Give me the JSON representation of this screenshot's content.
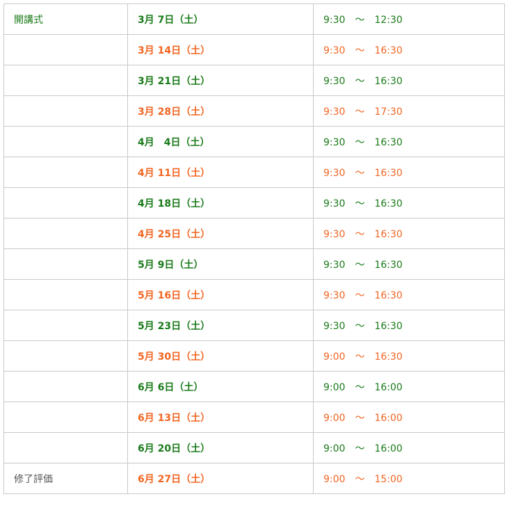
{
  "colors": {
    "green": "#1a7a1a",
    "orange": "#f26522",
    "label_gray": "#555555"
  },
  "rows": [
    {
      "label": "開講式",
      "date": "3月 7日（土）",
      "time": "9:30　～　12:30",
      "tone": "green"
    },
    {
      "label": "",
      "date": "3月 14日（土）",
      "time": "9:30　～　16:30",
      "tone": "orange"
    },
    {
      "label": "",
      "date": "3月 21日（土）",
      "time": "9:30　～　16:30",
      "tone": "green"
    },
    {
      "label": "",
      "date": "3月 28日（土）",
      "time": "9:30　～　17:30",
      "tone": "orange"
    },
    {
      "label": "",
      "date": "4月　4日（土）",
      "time": "9:30　～　16:30",
      "tone": "green"
    },
    {
      "label": "",
      "date": "4月 11日（土）",
      "time": "9:30　～　16:30",
      "tone": "orange"
    },
    {
      "label": "",
      "date": "4月 18日（土）",
      "time": "9:30　～　16:30",
      "tone": "green"
    },
    {
      "label": "",
      "date": "4月 25日（土）",
      "time": "9:30　～　16:30",
      "tone": "orange"
    },
    {
      "label": "",
      "date": "5月 9日（土）",
      "time": "9:30　～　16:30",
      "tone": "green"
    },
    {
      "label": "",
      "date": "5月 16日（土）",
      "time": "9:30　～　16:30",
      "tone": "orange"
    },
    {
      "label": "",
      "date": "5月 23日（土）",
      "time": "9:30　～　16:30",
      "tone": "green"
    },
    {
      "label": "",
      "date": "5月 30日（土）",
      "time": "9:00　～　16:30",
      "tone": "orange"
    },
    {
      "label": "",
      "date": "6月 6日（土）",
      "time": "9:00　～　16:00",
      "tone": "green"
    },
    {
      "label": "",
      "date": "6月 13日（土）",
      "time": "9:00　～　16:00",
      "tone": "orange"
    },
    {
      "label": "",
      "date": "6月 20日（土）",
      "time": "9:00　～　16:00",
      "tone": "green"
    },
    {
      "label": "修了評価",
      "date": "6月 27日（土）",
      "time": "9:00　～　15:00",
      "tone": "orange"
    }
  ]
}
